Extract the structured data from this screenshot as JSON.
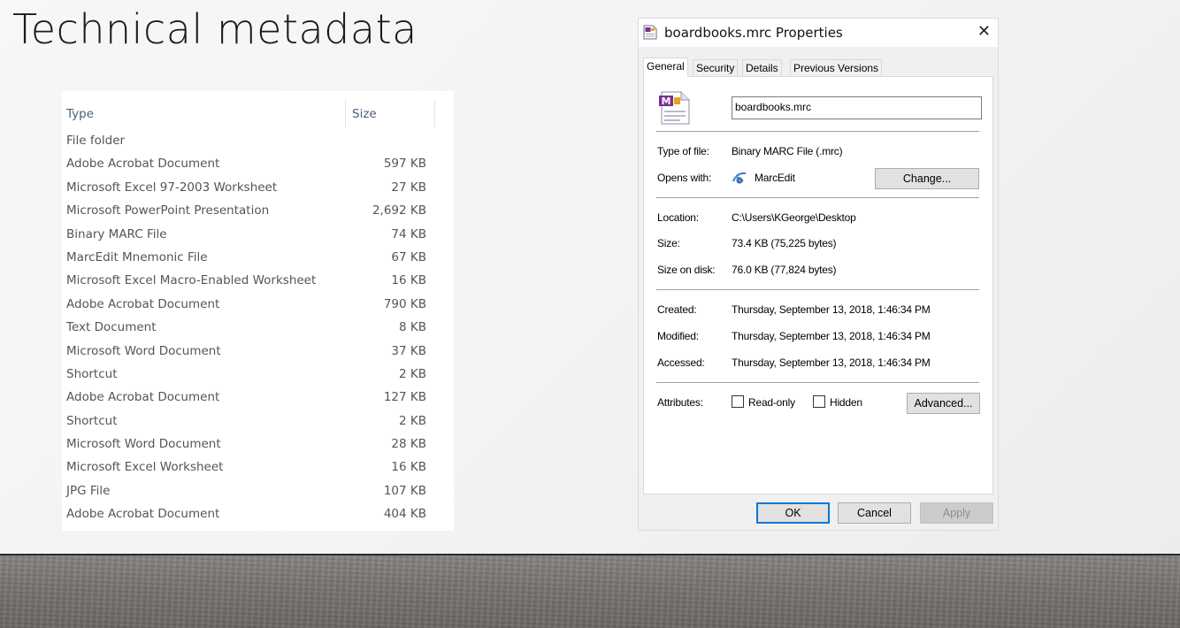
{
  "slide": {
    "title": "Technical metadata"
  },
  "file_list": {
    "columns": {
      "type": "Type",
      "size": "Size"
    },
    "rows": [
      {
        "type": "File folder",
        "size": ""
      },
      {
        "type": "Adobe Acrobat Document",
        "size": "597 KB"
      },
      {
        "type": "Microsoft Excel 97-2003 Worksheet",
        "size": "27 KB"
      },
      {
        "type": "Microsoft PowerPoint Presentation",
        "size": "2,692 KB"
      },
      {
        "type": "Binary MARC File",
        "size": "74 KB"
      },
      {
        "type": "MarcEdit Mnemonic File",
        "size": "67 KB"
      },
      {
        "type": "Microsoft Excel Macro-Enabled Worksheet",
        "size": "16 KB"
      },
      {
        "type": "Adobe Acrobat Document",
        "size": "790 KB"
      },
      {
        "type": "Text Document",
        "size": "8 KB"
      },
      {
        "type": "Microsoft Word Document",
        "size": "37 KB"
      },
      {
        "type": "Shortcut",
        "size": "2 KB"
      },
      {
        "type": "Adobe Acrobat Document",
        "size": "127 KB"
      },
      {
        "type": "Shortcut",
        "size": "2 KB"
      },
      {
        "type": "Microsoft Word Document",
        "size": "28 KB"
      },
      {
        "type": "Microsoft Excel Worksheet",
        "size": "16 KB"
      },
      {
        "type": "JPG File",
        "size": "107 KB"
      },
      {
        "type": "Adobe Acrobat Document",
        "size": "404 KB"
      }
    ]
  },
  "dialog": {
    "title": "boardbooks.mrc Properties",
    "close_glyph": "✕",
    "tabs": [
      "General",
      "Security",
      "Details",
      "Previous Versions"
    ],
    "active_tab": "General",
    "file_name": "boardbooks.mrc",
    "type_of_file": {
      "label": "Type of file:",
      "value": "Binary MARC File (.mrc)"
    },
    "opens_with": {
      "label": "Opens with:",
      "value": "MarcEdit",
      "change_label": "Change..."
    },
    "location": {
      "label": "Location:",
      "value": "C:\\Users\\KGeorge\\Desktop"
    },
    "size": {
      "label": "Size:",
      "value": "73.4 KB (75,225 bytes)"
    },
    "size_on_disk": {
      "label": "Size on disk:",
      "value": "76.0 KB (77,824 bytes)"
    },
    "created": {
      "label": "Created:",
      "value": "Thursday, September 13, 2018, 1:46:34 PM"
    },
    "modified": {
      "label": "Modified:",
      "value": "Thursday, September 13, 2018, 1:46:34 PM"
    },
    "accessed": {
      "label": "Accessed:",
      "value": "Thursday, September 13, 2018, 1:46:34 PM"
    },
    "attributes": {
      "label": "Attributes:",
      "read_only": {
        "label": "Read-only",
        "checked": false
      },
      "hidden": {
        "label": "Hidden",
        "checked": false
      },
      "advanced_label": "Advanced..."
    },
    "buttons": {
      "ok": "OK",
      "cancel": "Cancel",
      "apply": "Apply"
    },
    "icon_name": "marc-file-icon",
    "accent_color": "#0078d7"
  }
}
